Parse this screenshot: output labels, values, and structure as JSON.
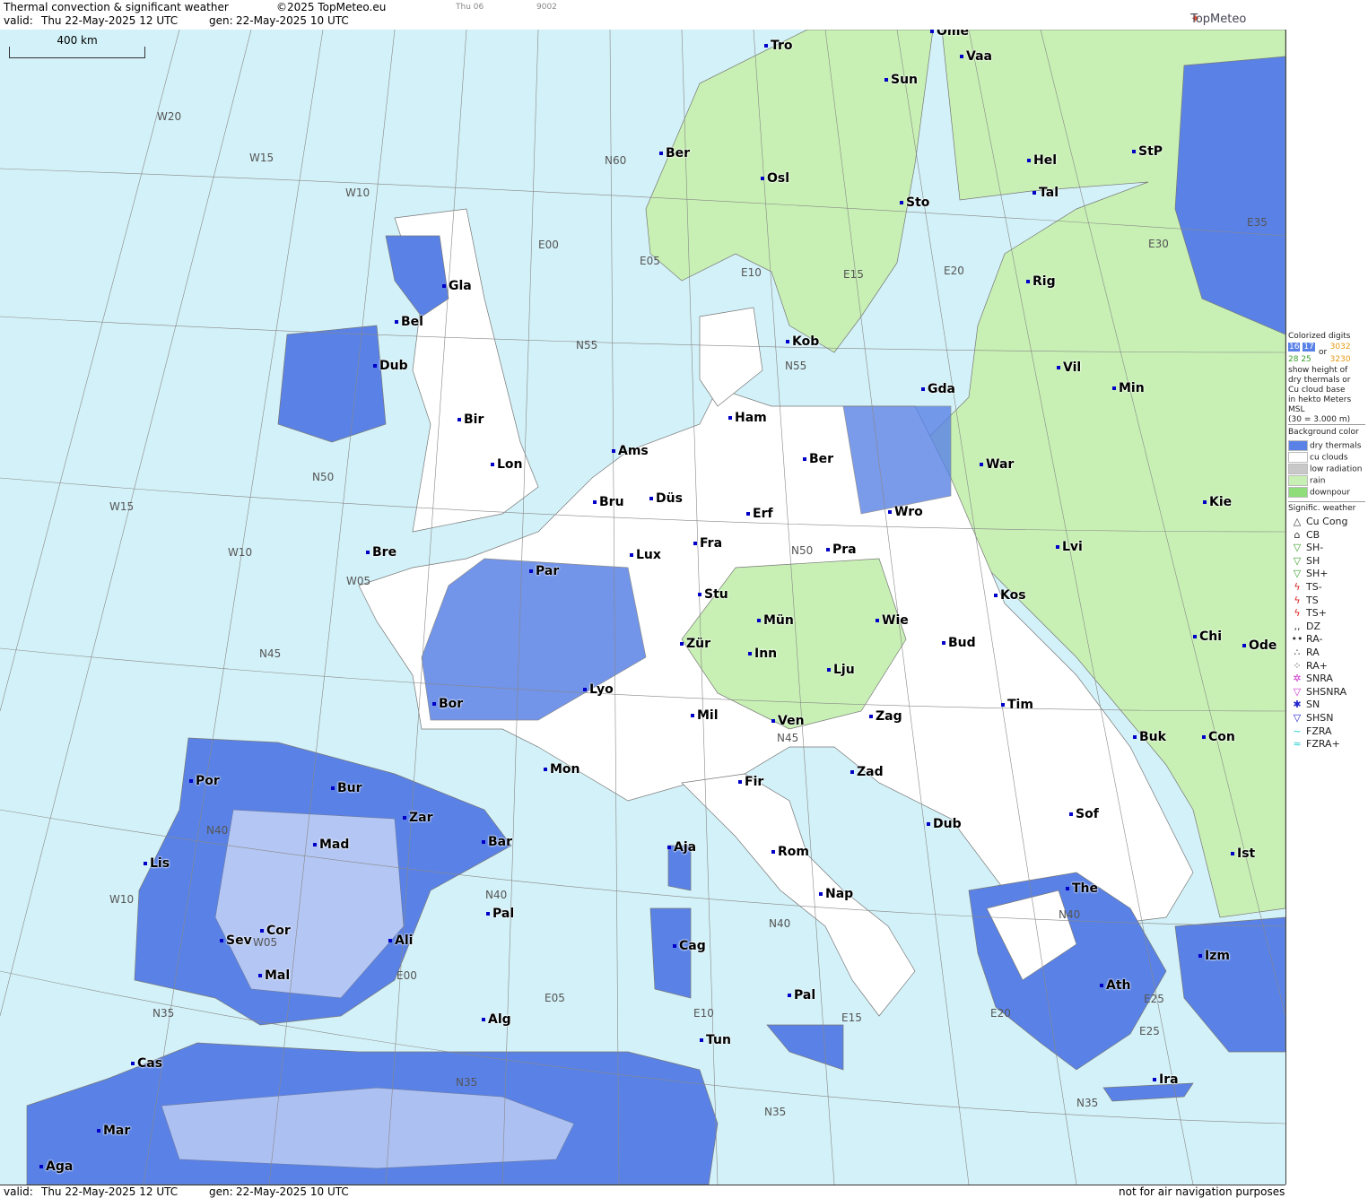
{
  "header": {
    "title": "Thermal convection & significant weather",
    "copyright": "©2025 TopMeteo.eu",
    "valid_label": "valid:",
    "valid_value": "Thu  22-May-2025  12 UTC",
    "gen_label": "gen:",
    "gen_value": "22-May-2025 10 UTC",
    "small1": "Thu 06",
    "small2": "9002",
    "logo": "TopMeteo"
  },
  "scale": {
    "label": "400 km"
  },
  "cities": [
    "Tro",
    "Sun",
    "Vaa",
    "Ber",
    "Osl",
    "Hel",
    "StP",
    "Sto",
    "Tal",
    "Rig",
    "Gla",
    "Bel",
    "Dub",
    "Kob",
    "Vil",
    "Min",
    "Gda",
    "Ham",
    "Bir",
    "Lon",
    "Ams",
    "Ber",
    "War",
    "Bru",
    "Düs",
    "Erf",
    "Wro",
    "Kie",
    "Lux",
    "Fra",
    "Pra",
    "Lvi",
    "Bre",
    "Par",
    "Stu",
    "Kos",
    "Mün",
    "Wie",
    "Chi",
    "Ode",
    "Zür",
    "Inn",
    "Bud",
    "Lyo",
    "Lju",
    "Tim",
    "Bor",
    "Mil",
    "Ven",
    "Zag",
    "Buk",
    "Con",
    "Mon",
    "Fir",
    "Zad",
    "Por",
    "Bur",
    "Zar",
    "Sof",
    "Dub",
    "Bar",
    "Aja",
    "Rom",
    "Mad",
    "Lis",
    "Ist",
    "Nap",
    "The",
    "Pal",
    "Cag",
    "Cor",
    "Sev",
    "Ali",
    "Izm",
    "Mal",
    "Ath",
    "Pal",
    "Tun",
    "Alg",
    "Cas",
    "Ira",
    "Mar",
    "Aga",
    "Ome"
  ],
  "grid_labels": [
    "W20",
    "W15",
    "W10",
    "W15",
    "W10",
    "W05",
    "W10",
    "W05",
    "E00",
    "E05",
    "E10",
    "E15",
    "E20",
    "E25",
    "E00",
    "E05",
    "E10",
    "E15",
    "E20",
    "E25",
    "N60",
    "N55",
    "N55",
    "N50",
    "N50",
    "N45",
    "N45",
    "N40",
    "N40",
    "N40",
    "N40",
    "N35",
    "N35",
    "N35",
    "N35",
    "E35",
    "E30"
  ],
  "legend": {
    "title": "Colorized digits",
    "or_label": "or",
    "example_nums": [
      "16",
      "17",
      "30",
      "32",
      "28",
      "25",
      "32",
      "30"
    ],
    "desc": [
      "show height of",
      "dry thermals or",
      "Cu cloud base",
      "in hekto Meters",
      "MSL",
      "(30 = 3.000 m)"
    ],
    "bg_title": "Background color",
    "bg_items": [
      {
        "label": "dry thermals",
        "color": "#5a82e6"
      },
      {
        "label": "cu clouds",
        "color": "#ffffff"
      },
      {
        "label": "low radiation",
        "color": "#c8c8c8"
      },
      {
        "label": "rain",
        "color": "#c8f0b4"
      },
      {
        "label": "downpour",
        "color": "#8edc7a"
      }
    ],
    "wx_title": "Signific. weather",
    "wx_items": [
      {
        "label": "Cu Cong",
        "sym": "△"
      },
      {
        "label": "CB",
        "sym": "⌂"
      },
      {
        "label": "SH-",
        "sym": "▽"
      },
      {
        "label": "SH",
        "sym": "▽"
      },
      {
        "label": "SH+",
        "sym": "▽"
      },
      {
        "label": "TS-",
        "sym": "ϟ"
      },
      {
        "label": "TS",
        "sym": "ϟ"
      },
      {
        "label": "TS+",
        "sym": "ϟ"
      },
      {
        "label": "DZ",
        "sym": ",,"
      },
      {
        "label": "RA-",
        "sym": "••"
      },
      {
        "label": "RA",
        "sym": "∴"
      },
      {
        "label": "RA+",
        "sym": "⁘"
      },
      {
        "label": "SNRA",
        "sym": "✲"
      },
      {
        "label": "SHSNRA",
        "sym": "▽"
      },
      {
        "label": "SN",
        "sym": "✱"
      },
      {
        "label": "SHSN",
        "sym": "▽"
      },
      {
        "label": "FZRA",
        "sym": "~"
      },
      {
        "label": "FZRA+",
        "sym": "≈"
      }
    ]
  },
  "footer": {
    "valid_label": "valid:",
    "valid_value": "Thu  22-May-2025  12 UTC",
    "gen_label": "gen:",
    "gen_value": "22-May-2025 10 UTC",
    "note": "not for air navigation purposes"
  },
  "colors": {
    "sea": "#d3f1f8",
    "land": "#ffffff",
    "dry_thermals": "#5a82e6",
    "rain": "#c8f0b4",
    "downpour": "#8edc7a",
    "low_radiation": "#c8c8c8",
    "city_marker": "#0000c8"
  }
}
